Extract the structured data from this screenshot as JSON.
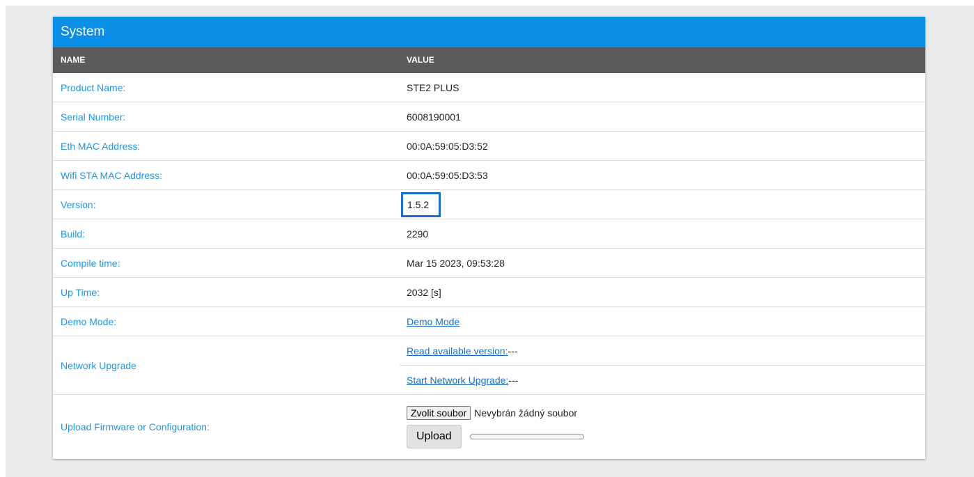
{
  "panel": {
    "title": "System"
  },
  "columns": {
    "name": "NAME",
    "value": "VALUE"
  },
  "rows": {
    "product_name": {
      "label": "Product Name:",
      "value": "STE2 PLUS"
    },
    "serial_number": {
      "label": "Serial Number:",
      "value": "6008190001"
    },
    "eth_mac": {
      "label": "Eth MAC Address:",
      "value": "00:0A:59:05:D3:52"
    },
    "wifi_mac": {
      "label": "Wifi STA MAC Address:",
      "value": "00:0A:59:05:D3:53"
    },
    "version": {
      "label": "Version:",
      "value": "1.5.2"
    },
    "build": {
      "label": "Build:",
      "value": "2290"
    },
    "compile_time": {
      "label": "Compile time:",
      "value": "Mar 15 2023, 09:53:28"
    },
    "up_time": {
      "label": "Up Time:",
      "value": "2032 [s]"
    },
    "demo_mode": {
      "label": "Demo Mode:",
      "link": "Demo Mode"
    },
    "network_upgrade": {
      "label": "Network Upgrade",
      "read_link": "Read available version:",
      "read_value": "---",
      "start_link": "Start Network Upgrade:",
      "start_value": "---"
    },
    "upload": {
      "label": "Upload Firmware or Configuration:",
      "choose_button": "Zvolit soubor",
      "no_file_text": "Nevybrán žádný soubor",
      "upload_button": "Upload",
      "progress": 0
    }
  },
  "colors": {
    "header_blue": "#0a8ee6",
    "column_header": "#5a5a5a",
    "label_blue": "#2196e0",
    "highlight_box": "#1e6ec9"
  }
}
